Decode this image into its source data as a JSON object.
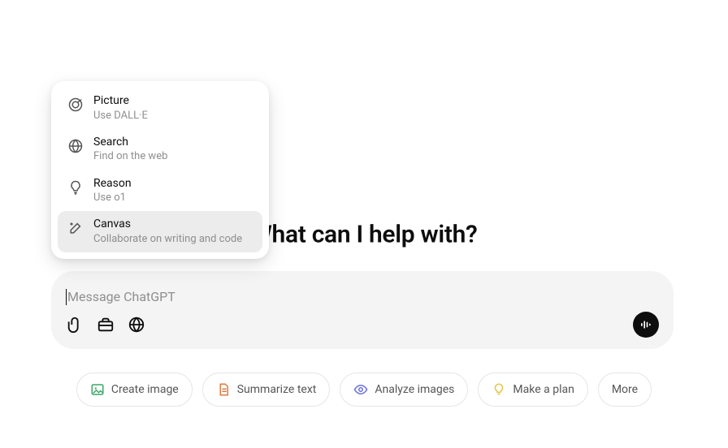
{
  "hero": {
    "title": "What can I help with?"
  },
  "dropdown": {
    "items": [
      {
        "title": "Picture",
        "subtitle": "Use DALL·E",
        "icon": "target",
        "active": false
      },
      {
        "title": "Search",
        "subtitle": "Find on the web",
        "icon": "globe",
        "active": false
      },
      {
        "title": "Reason",
        "subtitle": "Use o1",
        "icon": "bulb",
        "active": false
      },
      {
        "title": "Canvas",
        "subtitle": "Collaborate on writing and code",
        "icon": "pencil-plus",
        "active": true
      }
    ]
  },
  "input": {
    "placeholder": "Message ChatGPT",
    "icons": [
      "attach",
      "toolbox",
      "globe"
    ],
    "voice": true
  },
  "suggestions": [
    {
      "label": "Create image",
      "icon": "image",
      "color": "#3fa66a"
    },
    {
      "label": "Summarize text",
      "icon": "doc",
      "color": "#e07a3f"
    },
    {
      "label": "Analyze images",
      "icon": "eye",
      "color": "#6a6fd9"
    },
    {
      "label": "Make a plan",
      "icon": "bulb-fill",
      "color": "#e4c548"
    },
    {
      "label": "More",
      "icon": "",
      "color": ""
    }
  ]
}
